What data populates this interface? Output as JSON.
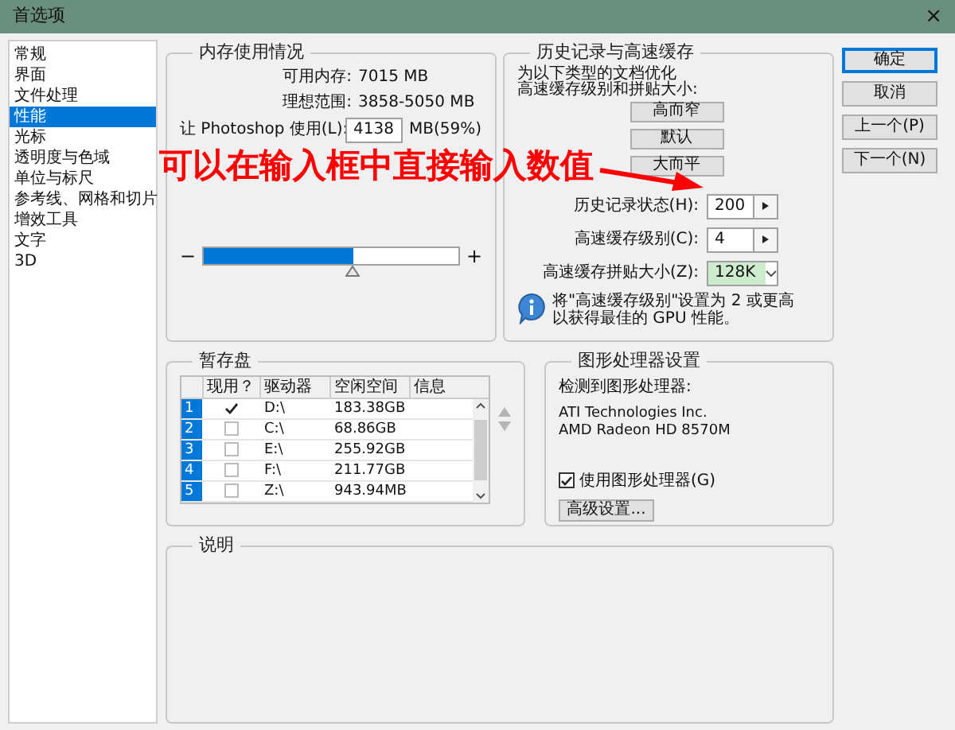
{
  "window": {
    "title": "首选项",
    "close": "×"
  },
  "sidebar": {
    "items": [
      {
        "label": "常规",
        "selected": false
      },
      {
        "label": "界面",
        "selected": false
      },
      {
        "label": "文件处理",
        "selected": false
      },
      {
        "label": "性能",
        "selected": true
      },
      {
        "label": "光标",
        "selected": false
      },
      {
        "label": "透明度与色域",
        "selected": false
      },
      {
        "label": "单位与标尺",
        "selected": false
      },
      {
        "label": "参考线、网格和切片",
        "selected": false
      },
      {
        "label": "增效工具",
        "selected": false
      },
      {
        "label": "文字",
        "selected": false
      },
      {
        "label": "3D",
        "selected": false
      }
    ]
  },
  "memory": {
    "title": "内存使用情况",
    "available_label": "可用内存:",
    "available_value": "7015 MB",
    "range_label": "理想范围:",
    "range_value": "3858-5050 MB",
    "use_label": "让 Photoshop 使用(L):",
    "use_value": "4138",
    "use_unit": "MB(59%)",
    "minus": "−",
    "plus": "+",
    "level": 0.59
  },
  "history": {
    "title": "历史记录与高速缓存",
    "intro": [
      "为以下类型的文档优化",
      "高速缓存级别和拼贴大小:"
    ],
    "presets": [
      "高而窄",
      "默认",
      "大而平"
    ],
    "fields": [
      {
        "kind": "spinner",
        "label": "历史记录状态(H):",
        "value": "200"
      },
      {
        "kind": "spinner",
        "label": "高速缓存级别(C):",
        "value": "4"
      },
      {
        "kind": "dropdown",
        "label": "高速缓存拼贴大小(Z):",
        "value": "128K"
      }
    ],
    "info": "将\"高速缓存级别\"设置为 2 或更高以获得最佳的 GPU 性能。"
  },
  "dialog_buttons": [
    {
      "label": "确定",
      "default": true
    },
    {
      "label": "取消",
      "default": false
    },
    {
      "label": "上一个(P)",
      "default": false
    },
    {
      "label": "下一个(N)",
      "default": false
    }
  ],
  "scratch": {
    "title": "暂存盘",
    "columns": [
      "现用？",
      "驱动器",
      "空闲空间",
      "信息"
    ],
    "rows": [
      {
        "index": "1",
        "checked": true,
        "drive": "D:\\",
        "free": "183.38GB"
      },
      {
        "index": "2",
        "checked": false,
        "drive": "C:\\",
        "free": "68.86GB"
      },
      {
        "index": "3",
        "checked": false,
        "drive": "E:\\",
        "free": "255.92GB"
      },
      {
        "index": "4",
        "checked": false,
        "drive": "F:\\",
        "free": "211.77GB"
      },
      {
        "index": "5",
        "checked": false,
        "drive": "Z:\\",
        "free": "943.94MB"
      }
    ]
  },
  "gpu": {
    "title": "图形处理器设置",
    "detected_label": "检测到图形处理器:",
    "vendor": "ATI Technologies Inc.",
    "model": "AMD Radeon HD 8570M",
    "use_gpu": {
      "label": "使用图形处理器(G)",
      "checked": true
    },
    "advanced": "高级设置..."
  },
  "description": {
    "title": "说明"
  },
  "annotation": {
    "text": "可以在输入框中直接输入数值"
  }
}
